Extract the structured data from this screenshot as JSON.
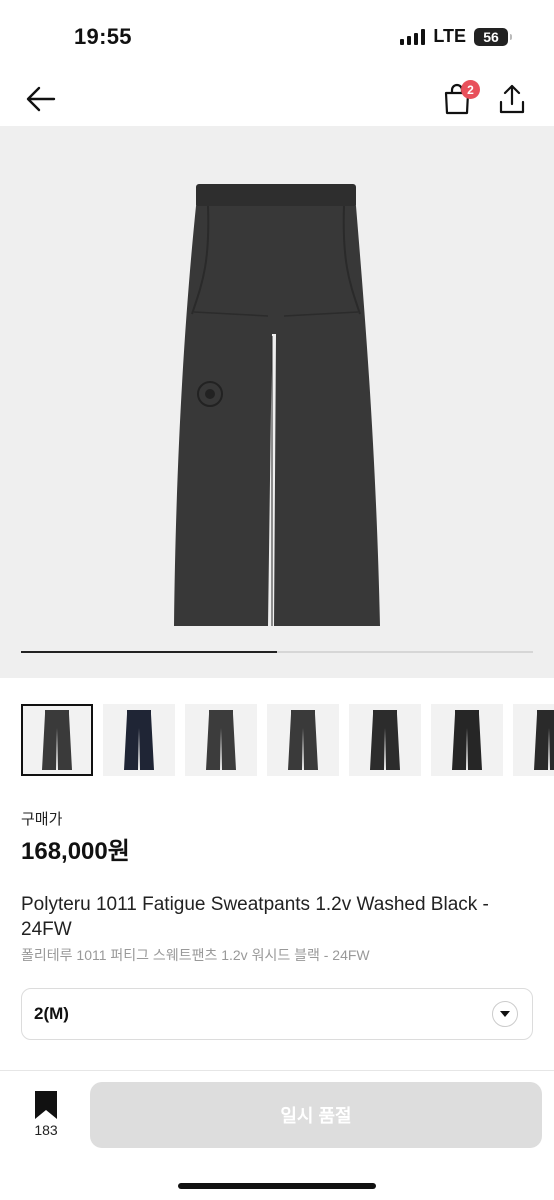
{
  "status_bar": {
    "time": "19:55",
    "network": "LTE",
    "battery": "56"
  },
  "nav": {
    "cart_badge": "2",
    "icons": [
      "back-arrow-icon",
      "shopping-bag-icon",
      "share-icon"
    ]
  },
  "gallery": {
    "progress": 0.5,
    "thumbnail_count": 7,
    "selected_thumbnail": 1
  },
  "price": {
    "label": "구매가",
    "value": "168,000원"
  },
  "product": {
    "title": "Polyteru 1011 Fatigue Sweatpants 1.2v Washed Black - 24FW",
    "subtitle": "폴리테루 1011 퍼티그 스웨트팬츠 1.2v 워시드 블랙 - 24FW"
  },
  "size_select": {
    "value": "2(M)"
  },
  "bottom_bar": {
    "bookmark_count": "183",
    "action_label": "일시 품절"
  },
  "colors": {
    "badge": "#e8505b",
    "button_disabled": "#dddddd"
  }
}
